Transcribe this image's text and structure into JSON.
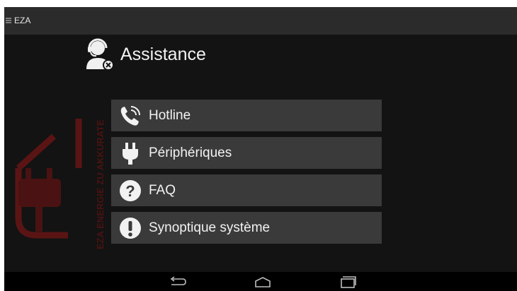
{
  "app": {
    "title": "EZA"
  },
  "page": {
    "title": "Assistance"
  },
  "watermark": {
    "text": "EZA ENERGIE ZU AKKURATE"
  },
  "menu": {
    "items": [
      {
        "label": "Hotline",
        "icon": "phone-icon"
      },
      {
        "label": "Périphériques",
        "icon": "plug-icon"
      },
      {
        "label": "FAQ",
        "icon": "question-icon"
      },
      {
        "label": "Synoptique système",
        "icon": "exclamation-icon"
      }
    ]
  },
  "nav": {
    "buttons": [
      "back-icon",
      "home-icon",
      "recents-icon"
    ]
  },
  "colors": {
    "background": "#131313",
    "topbar": "#2b2b2b",
    "menu_item": "#3a3a3a",
    "watermark": "#6b1515",
    "text": "#f2f2f2"
  }
}
